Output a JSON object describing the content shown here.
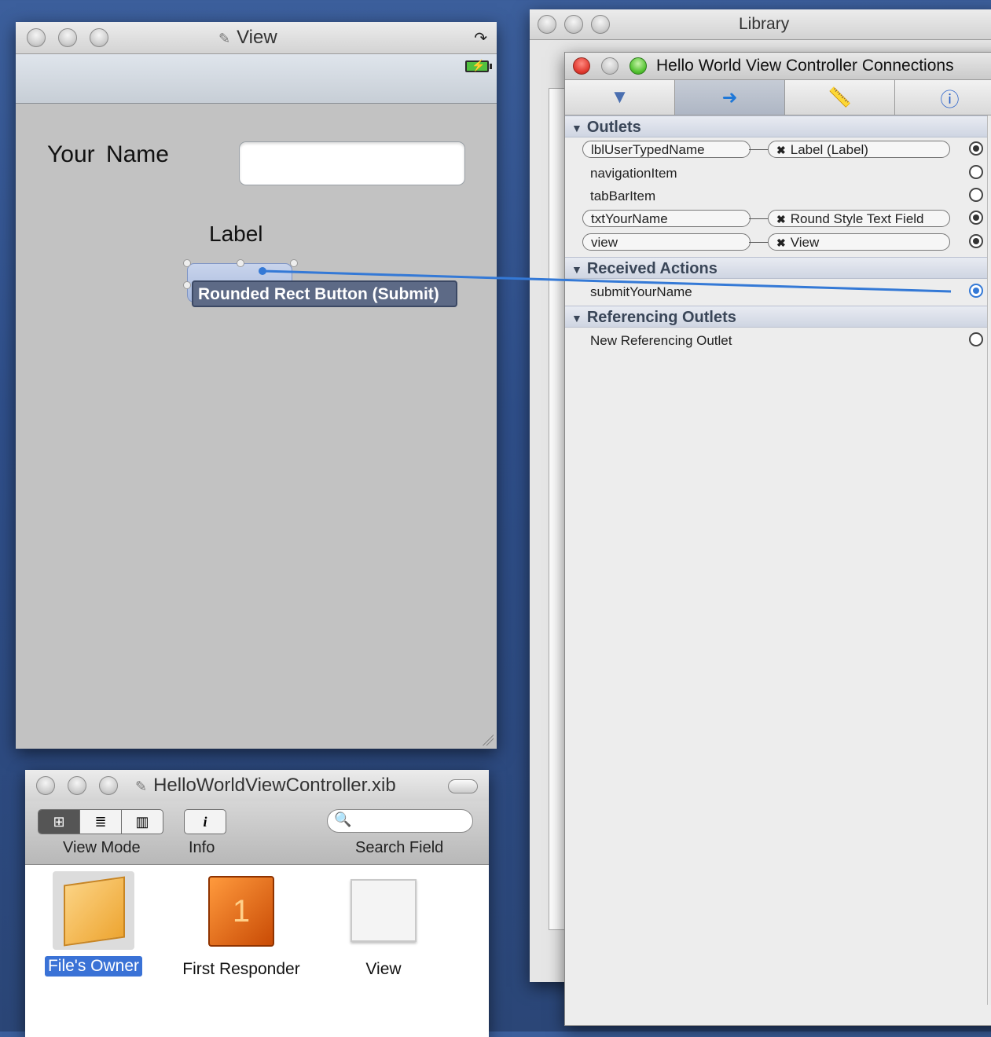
{
  "view_window": {
    "title": "View",
    "your_name_label": "Your  Name",
    "label_text": "Label",
    "submit_label": "Submit",
    "tooltip": "Rounded Rect Button (Submit)"
  },
  "library_window": {
    "title": "Library"
  },
  "connections_panel": {
    "title": "Hello World View Controller Connections",
    "tabs": [
      "attributes-icon",
      "connections-icon",
      "size-icon",
      "info-icon"
    ],
    "outlets": {
      "header": "Outlets",
      "rows": [
        {
          "name": "lblUserTypedName",
          "target": "Label (Label)",
          "connected": true
        },
        {
          "name": "navigationItem",
          "target": "",
          "connected": false
        },
        {
          "name": "tabBarItem",
          "target": "",
          "connected": false
        },
        {
          "name": "txtYourName",
          "target": "Round Style Text Field",
          "connected": true
        },
        {
          "name": "view",
          "target": "View",
          "connected": true
        }
      ]
    },
    "received_actions": {
      "header": "Received Actions",
      "rows": [
        {
          "name": "submitYourName"
        }
      ]
    },
    "referencing_outlets": {
      "header": "Referencing Outlets",
      "rows": [
        {
          "name": "New Referencing Outlet"
        }
      ]
    }
  },
  "xib_window": {
    "title": "HelloWorldViewController.xib",
    "view_mode_label": "View Mode",
    "info_label": "Info",
    "search_label": "Search Field",
    "items": [
      {
        "label": "File's Owner",
        "selected": true
      },
      {
        "label": "First Responder",
        "selected": false
      },
      {
        "label": "View",
        "selected": false
      }
    ]
  },
  "colors": {
    "accent": "#3a72d6",
    "connection_line": "#3479d6"
  }
}
